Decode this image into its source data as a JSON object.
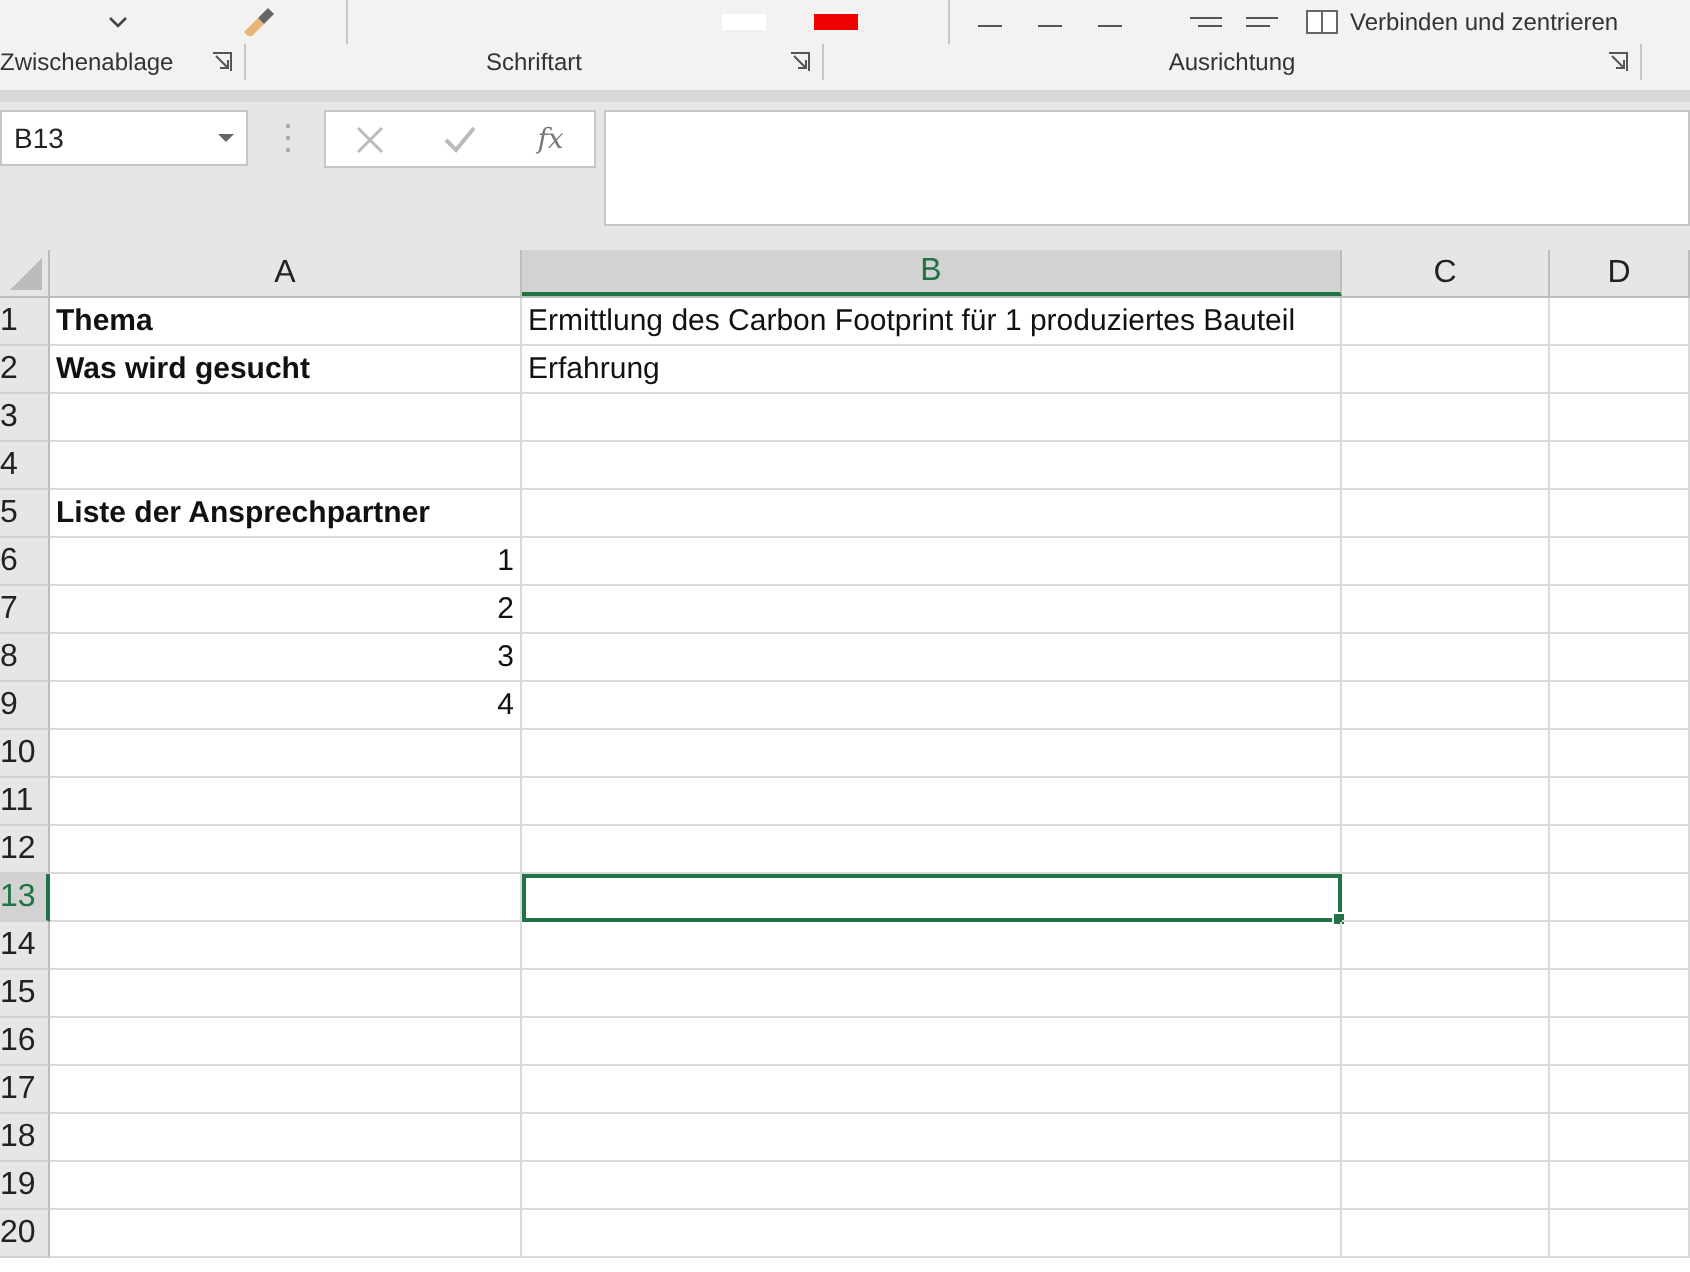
{
  "ribbon": {
    "merge_button": "Verbinden und zentrieren",
    "groups": [
      {
        "label": "Zwischenablage",
        "launcher": true
      },
      {
        "label": "Schriftart",
        "launcher": true
      },
      {
        "label": "Ausrichtung",
        "launcher": true
      }
    ]
  },
  "formula_bar": {
    "name_box": "B13",
    "fx": "fx"
  },
  "columns": [
    {
      "label": "A",
      "selected": false
    },
    {
      "label": "B",
      "selected": true
    },
    {
      "label": "C",
      "selected": false
    },
    {
      "label": "D",
      "selected": false
    }
  ],
  "rows": [
    {
      "label": "1",
      "selected": false,
      "cells": [
        {
          "text": "Thema",
          "bold": true,
          "kind": "text"
        },
        {
          "text": "Ermittlung des Carbon Footprint für 1 produziertes Bauteil",
          "bold": false,
          "kind": "text"
        },
        null,
        null
      ]
    },
    {
      "label": "2",
      "selected": false,
      "cells": [
        {
          "text": "Was wird gesucht",
          "bold": true,
          "kind": "text"
        },
        {
          "text": "Erfahrung",
          "bold": false,
          "kind": "text"
        },
        null,
        null
      ]
    },
    {
      "label": "3",
      "selected": false,
      "cells": [
        null,
        null,
        null,
        null
      ]
    },
    {
      "label": "4",
      "selected": false,
      "cells": [
        null,
        null,
        null,
        null
      ]
    },
    {
      "label": "5",
      "selected": false,
      "cells": [
        {
          "text": "Liste der Ansprechpartner",
          "bold": true,
          "kind": "text"
        },
        null,
        null,
        null
      ]
    },
    {
      "label": "6",
      "selected": false,
      "cells": [
        {
          "text": "1",
          "bold": false,
          "kind": "number"
        },
        null,
        null,
        null
      ]
    },
    {
      "label": "7",
      "selected": false,
      "cells": [
        {
          "text": "2",
          "bold": false,
          "kind": "number"
        },
        null,
        null,
        null
      ]
    },
    {
      "label": "8",
      "selected": false,
      "cells": [
        {
          "text": "3",
          "bold": false,
          "kind": "number"
        },
        null,
        null,
        null
      ]
    },
    {
      "label": "9",
      "selected": false,
      "cells": [
        {
          "text": "4",
          "bold": false,
          "kind": "number"
        },
        null,
        null,
        null
      ]
    },
    {
      "label": "10",
      "selected": false,
      "cells": [
        null,
        null,
        null,
        null
      ]
    },
    {
      "label": "11",
      "selected": false,
      "cells": [
        null,
        null,
        null,
        null
      ]
    },
    {
      "label": "12",
      "selected": false,
      "cells": [
        null,
        null,
        null,
        null
      ]
    },
    {
      "label": "13",
      "selected": true,
      "cells": [
        null,
        {
          "selected": true
        },
        null,
        null
      ]
    },
    {
      "label": "14",
      "selected": false,
      "cells": [
        null,
        null,
        null,
        null
      ]
    },
    {
      "label": "15",
      "selected": false,
      "cells": [
        null,
        null,
        null,
        null
      ]
    },
    {
      "label": "16",
      "selected": false,
      "cells": [
        null,
        null,
        null,
        null
      ]
    },
    {
      "label": "17",
      "selected": false,
      "cells": [
        null,
        null,
        null,
        null
      ]
    },
    {
      "label": "18",
      "selected": false,
      "cells": [
        null,
        null,
        null,
        null
      ]
    },
    {
      "label": "19",
      "selected": false,
      "cells": [
        null,
        null,
        null,
        null
      ]
    },
    {
      "label": "20",
      "selected": false,
      "cells": [
        null,
        null,
        null,
        null
      ]
    }
  ]
}
